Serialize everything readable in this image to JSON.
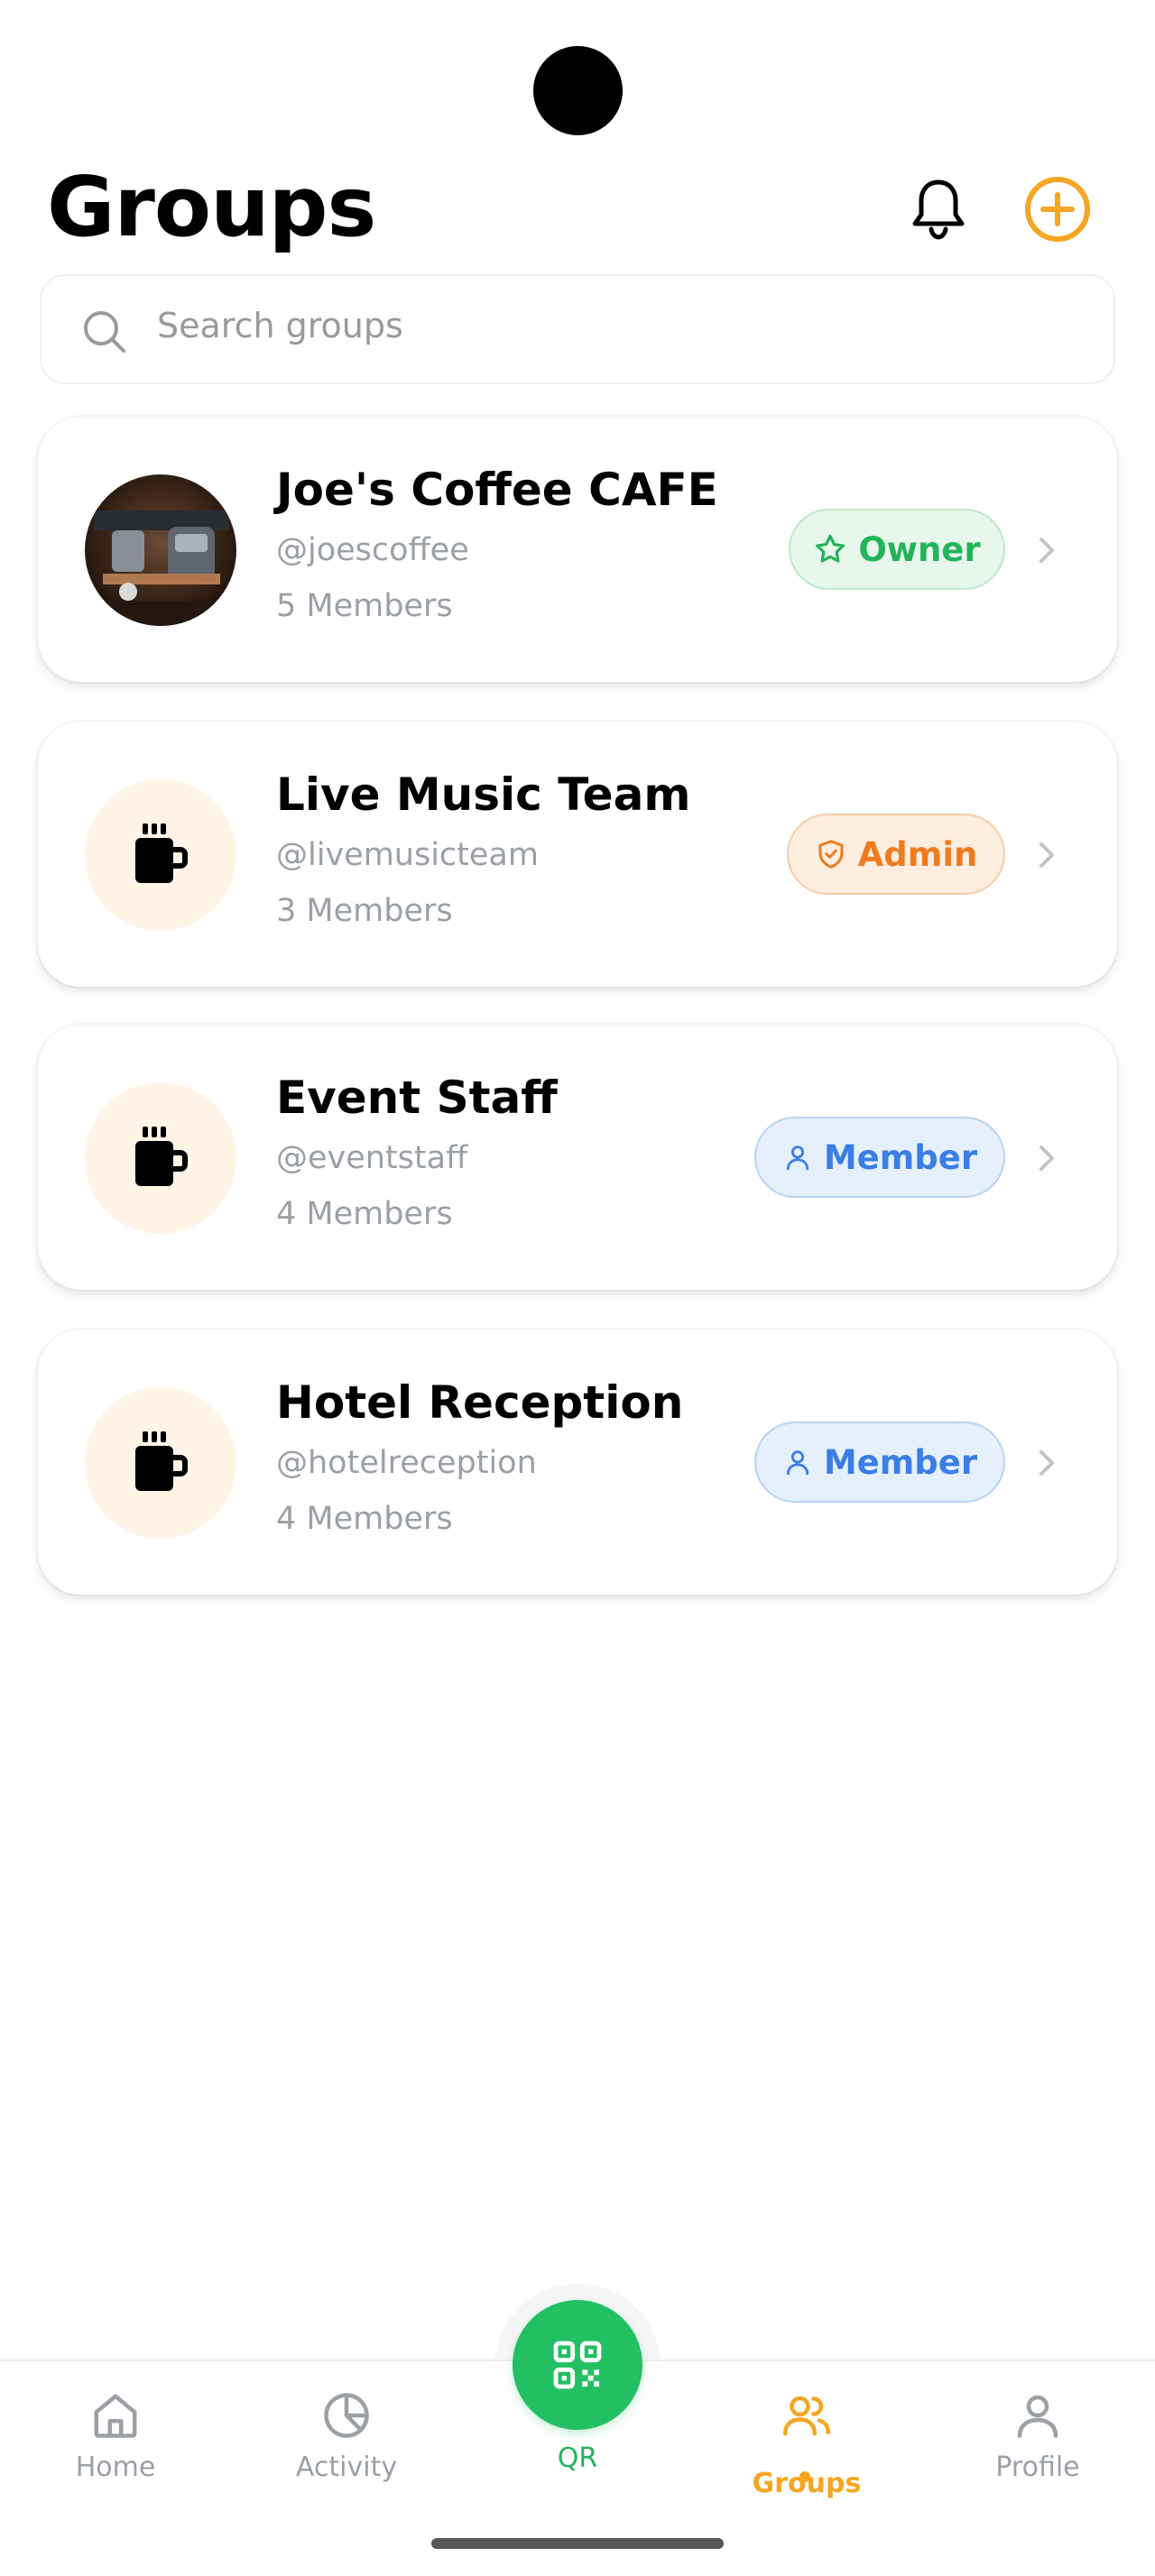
{
  "header": {
    "title": "Groups",
    "icons": {
      "notifications": "bell-icon",
      "add": "plus-circle-icon"
    }
  },
  "search": {
    "placeholder": "Search groups",
    "value": ""
  },
  "groups": [
    {
      "name": "Joe's Coffee CAFE",
      "handle": "@joescoffee",
      "members": "5 Members",
      "role": "Owner",
      "role_icon": "star-icon",
      "avatar": "photo"
    },
    {
      "name": "Live Music Team",
      "handle": "@livemusicteam",
      "members": "3 Members",
      "role": "Admin",
      "role_icon": "shield-icon",
      "avatar": "mug-icon"
    },
    {
      "name": "Event Staff",
      "handle": "@eventstaff",
      "members": "4 Members",
      "role": "Member",
      "role_icon": "person-icon",
      "avatar": "mug-icon"
    },
    {
      "name": "Hotel Reception",
      "handle": "@hotelreception",
      "members": "4 Members",
      "role": "Member",
      "role_icon": "person-icon",
      "avatar": "mug-icon"
    }
  ],
  "bottom_nav": {
    "items": [
      {
        "label": "Home",
        "icon": "home-icon"
      },
      {
        "label": "Activity",
        "icon": "pie-chart-icon"
      },
      {
        "label": "QR",
        "icon": "qr-code-icon"
      },
      {
        "label": "Groups",
        "icon": "users-icon",
        "active": true
      },
      {
        "label": "Profile",
        "icon": "user-icon"
      }
    ]
  },
  "colors": {
    "accent_orange": "#f6a623",
    "owner_green": "#22b35b",
    "admin_orange": "#f07a1e",
    "member_blue": "#3a7ee6",
    "qr_green": "#22c063",
    "muted_text": "#9aa0a6"
  }
}
